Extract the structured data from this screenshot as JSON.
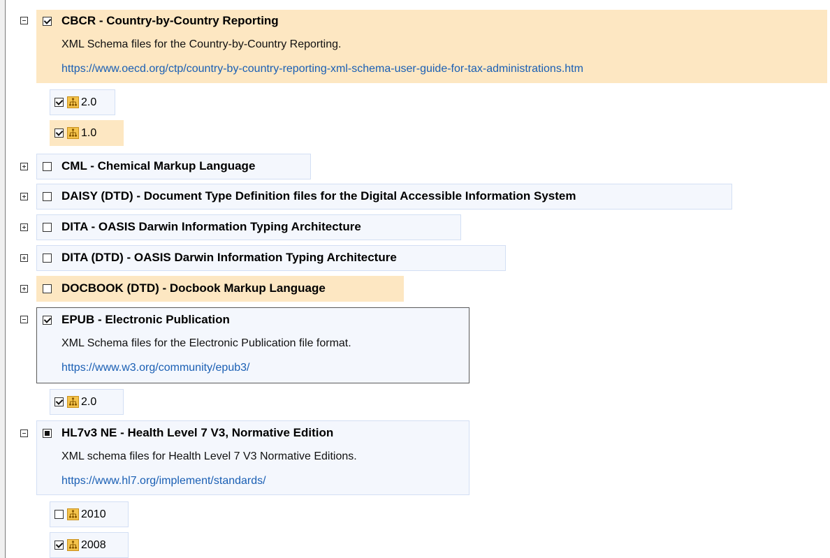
{
  "colors": {
    "selected_bg": "#fde7c2",
    "item_bg": "#f4f7fd",
    "item_border": "#d3dff4",
    "link": "#1a5fb4",
    "schema_icon": "#f3c24b"
  },
  "tree": [
    {
      "title": "CBCR - Country-by-Country Reporting",
      "expanded": true,
      "check_state": "checked",
      "description": "XML Schema files for the Country-by-Country Reporting.",
      "url": "https://www.oecd.org/ctp/country-by-country-reporting-xml-schema-user-guide-for-tax-administrations.htm",
      "versions": [
        {
          "label": "2.0",
          "check_state": "checked"
        },
        {
          "label": "1.0",
          "check_state": "checked"
        }
      ]
    },
    {
      "title": "CML - Chemical Markup Language",
      "expanded": false,
      "check_state": "unchecked"
    },
    {
      "title": "DAISY (DTD) - Document Type Definition files for the Digital Accessible Information System",
      "expanded": false,
      "check_state": "unchecked"
    },
    {
      "title": "DITA - OASIS Darwin Information Typing Architecture",
      "expanded": false,
      "check_state": "unchecked"
    },
    {
      "title": "DITA (DTD) - OASIS Darwin Information Typing Architecture",
      "expanded": false,
      "check_state": "unchecked"
    },
    {
      "title": "DOCBOOK (DTD) - Docbook Markup Language",
      "expanded": false,
      "check_state": "unchecked"
    },
    {
      "title": "EPUB - Electronic Publication",
      "expanded": true,
      "check_state": "checked",
      "description": "XML Schema files for the Electronic Publication file format.",
      "url": "https://www.w3.org/community/epub3/",
      "versions": [
        {
          "label": "2.0",
          "check_state": "checked"
        }
      ]
    },
    {
      "title": "HL7v3 NE - Health Level 7 V3, Normative Edition",
      "expanded": true,
      "check_state": "partial",
      "description": "XML schema files for Health Level 7 V3 Normative Editions.",
      "url": "https://www.hl7.org/implement/standards/",
      "versions": [
        {
          "label": "2010",
          "check_state": "unchecked"
        },
        {
          "label": "2008",
          "check_state": "checked"
        }
      ]
    }
  ]
}
